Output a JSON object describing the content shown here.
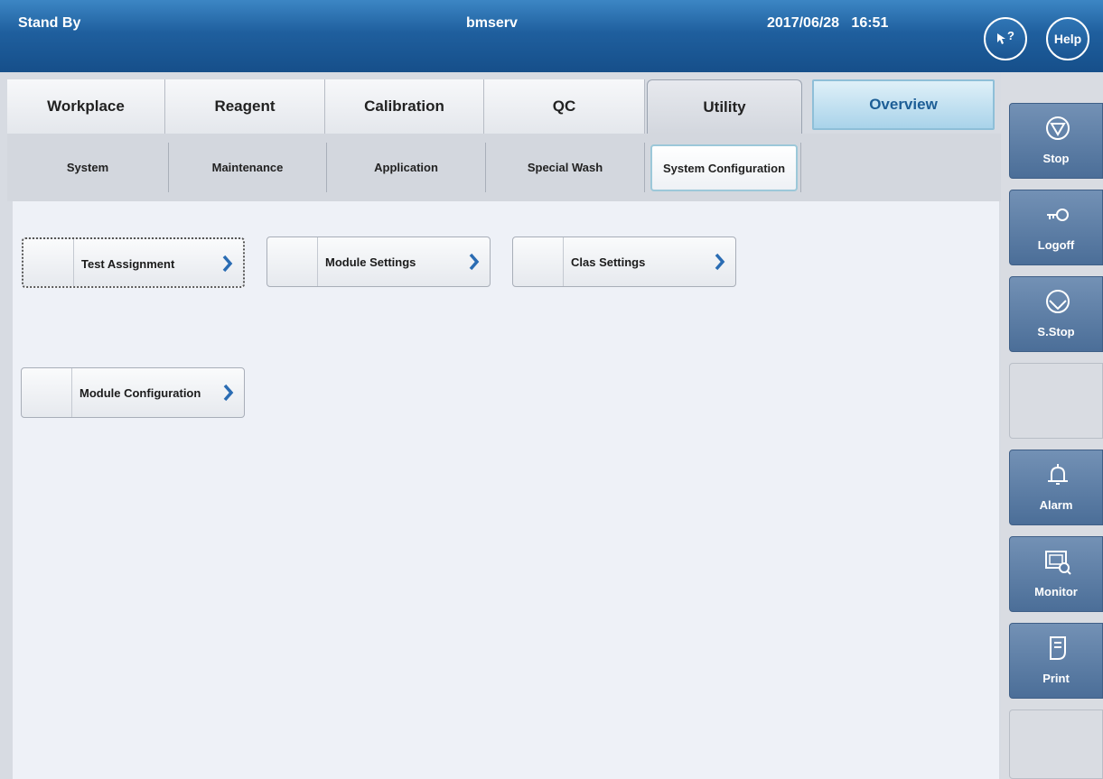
{
  "header": {
    "status": "Stand By",
    "user": "bmserv",
    "datetime": "2017/06/28   16:51",
    "pointer_help_label": "?",
    "help_label": "Help"
  },
  "main_tabs": [
    "Workplace",
    "Reagent",
    "Calibration",
    "QC",
    "Utility",
    "Overview"
  ],
  "active_main_tab": "Utility",
  "sub_tabs": [
    "System",
    "Maintenance",
    "Application",
    "Special Wash",
    "System Configuration"
  ],
  "active_sub_tab": "System Configuration",
  "functions": [
    {
      "label": "Test Assignment"
    },
    {
      "label": "Module Settings"
    },
    {
      "label": "Clas Settings"
    },
    {
      "label": "Module Configuration"
    }
  ],
  "side_buttons": [
    {
      "label": "Stop",
      "icon": "stop-icon"
    },
    {
      "label": "Logoff",
      "icon": "key-icon"
    },
    {
      "label": "S.Stop",
      "icon": "sampling-stop-icon"
    },
    {
      "label": "",
      "icon": ""
    },
    {
      "label": "Alarm",
      "icon": "bell-icon"
    },
    {
      "label": "Monitor",
      "icon": "monitor-icon"
    },
    {
      "label": "Print",
      "icon": "print-icon"
    },
    {
      "label": "",
      "icon": ""
    }
  ],
  "colors": {
    "header_blue": "#1f5f9e",
    "chevron_blue": "#2a6cb3",
    "side_button_blue": "#5a7ca6"
  }
}
